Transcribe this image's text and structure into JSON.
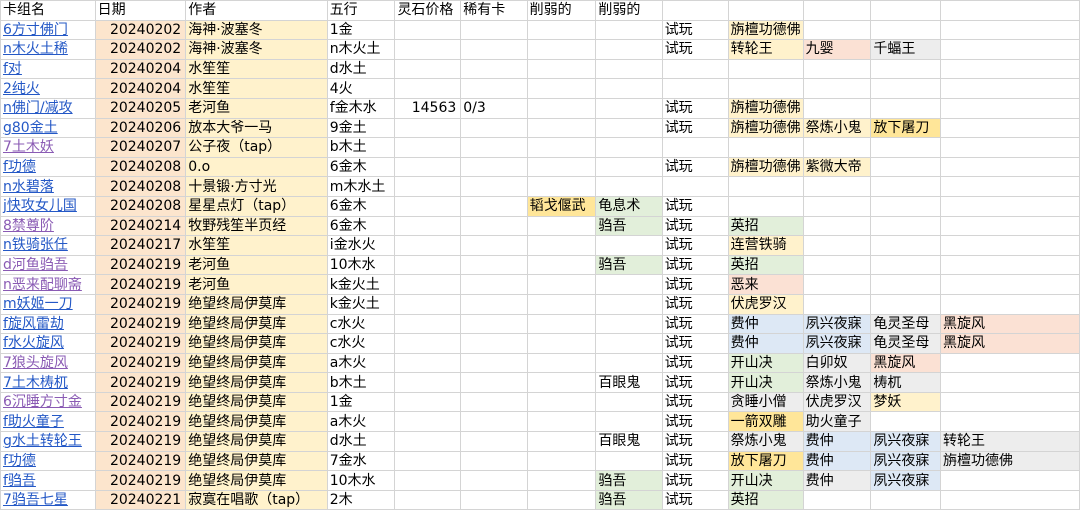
{
  "header": [
    "卡组名",
    "日期",
    "作者",
    "五行",
    "灵石价格",
    "稀有卡",
    "削弱的",
    "削弱的",
    "",
    "",
    "",
    "",
    ""
  ],
  "rows": [
    [
      "6方寸佛门",
      "20240202",
      "海神·波塞冬",
      "1金",
      "",
      "",
      "",
      "",
      "试玩",
      "旃檀功德佛",
      "",
      "",
      ""
    ],
    [
      "n木火土稀",
      "20240202",
      "海神·波塞冬",
      "n木火土",
      "",
      "",
      "",
      "",
      "试玩",
      "转轮王",
      "九婴",
      "千蝠王",
      ""
    ],
    [
      "f对",
      "20240204",
      "水笙笙",
      "d水土",
      "",
      "",
      "",
      "",
      "",
      "",
      "",
      "",
      ""
    ],
    [
      "2纯火",
      "20240204",
      "水笙笙",
      "4火",
      "",
      "",
      "",
      "",
      "",
      "",
      "",
      "",
      ""
    ],
    [
      "n佛门/减攻",
      "20240205",
      "老河鱼",
      "f金木水",
      "14563",
      "0/3",
      "",
      "",
      "试玩",
      "旃檀功德佛",
      "",
      "",
      ""
    ],
    [
      "g80金土",
      "20240206",
      "放本大爷一马",
      "9金土",
      "",
      "",
      "",
      "",
      "试玩",
      "旃檀功德佛",
      "祭炼小鬼",
      "放下屠刀",
      ""
    ],
    [
      "7土木妖",
      "20240207",
      "公子夜（tap）",
      "b木土",
      "",
      "",
      "",
      "",
      "",
      "",
      "",
      "",
      ""
    ],
    [
      "f功德",
      "20240208",
      "0.o",
      "6金木",
      "",
      "",
      "",
      "",
      "试玩",
      "旃檀功德佛",
      "紫微大帝",
      "",
      ""
    ],
    [
      "n水碧落",
      "20240208",
      "十景锻·方寸光",
      "m木水土",
      "",
      "",
      "",
      "",
      "",
      "",
      "",
      "",
      ""
    ],
    [
      "j快攻女儿国",
      "20240208",
      "星星点灯（tap）",
      "6金木",
      "",
      "",
      "韬戈偃武",
      "龟息术",
      "试玩",
      "",
      "",
      "",
      ""
    ],
    [
      "8禁尊阶",
      "20240214",
      "牧野残笙半页经",
      "6金木",
      "",
      "",
      "",
      "驺吾",
      "试玩",
      "英招",
      "",
      "",
      ""
    ],
    [
      "n铁骑张任",
      "20240217",
      "水笙笙",
      "i金水火",
      "",
      "",
      "",
      "",
      "试玩",
      "连营铁骑",
      "",
      "",
      ""
    ],
    [
      "d河鱼驺吾",
      "20240219",
      "老河鱼",
      "10木水",
      "",
      "",
      "",
      "驺吾",
      "试玩",
      "英招",
      "",
      "",
      ""
    ],
    [
      "n恶来配聊斋",
      "20240219",
      "老河鱼",
      "k金火土",
      "",
      "",
      "",
      "",
      "试玩",
      "恶来",
      "",
      "",
      ""
    ],
    [
      "m妖姬一刀",
      "20240219",
      "绝望终局伊莫库",
      "k金火土",
      "",
      "",
      "",
      "",
      "试玩",
      "伏虎罗汉",
      "",
      "",
      ""
    ],
    [
      "f旋风雷劫",
      "20240219",
      "绝望终局伊莫库",
      "c水火",
      "",
      "",
      "",
      "",
      "试玩",
      "费仲",
      "夙兴夜寐",
      "龟灵圣母",
      "黑旋风"
    ],
    [
      "f水火旋风",
      "20240219",
      "绝望终局伊莫库",
      "c水火",
      "",
      "",
      "",
      "",
      "试玩",
      "费仲",
      "夙兴夜寐",
      "龟灵圣母",
      "黑旋风"
    ],
    [
      "7狼头旋风",
      "20240219",
      "绝望终局伊莫库",
      "a木火",
      "",
      "",
      "",
      "",
      "试玩",
      "开山决",
      "白卯奴",
      "黑旋风",
      ""
    ],
    [
      "7土木梼杌",
      "20240219",
      "绝望终局伊莫库",
      "b木土",
      "",
      "",
      "",
      "百眼鬼",
      "试玩",
      "开山决",
      "祭炼小鬼",
      "梼杌",
      ""
    ],
    [
      "6沉睡方寸金",
      "20240219",
      "绝望终局伊莫库",
      "1金",
      "",
      "",
      "",
      "",
      "试玩",
      "贪睡小僧",
      "伏虎罗汉",
      "梦妖",
      ""
    ],
    [
      "f助火童子",
      "20240219",
      "绝望终局伊莫库",
      "a木火",
      "",
      "",
      "",
      "",
      "试玩",
      "一箭双雕",
      "助火童子",
      "",
      ""
    ],
    [
      "g水土转轮王",
      "20240219",
      "绝望终局伊莫库",
      "d水土",
      "",
      "",
      "",
      "百眼鬼",
      "试玩",
      "祭炼小鬼",
      "费仲",
      "夙兴夜寐",
      "转轮王",
      "千蝠王"
    ],
    [
      "f功德",
      "20240219",
      "绝望终局伊莫库",
      "7金水",
      "",
      "",
      "",
      "",
      "试玩",
      "放下屠刀",
      "费仲",
      "夙兴夜寐",
      "旃檀功德佛",
      ""
    ],
    [
      "f驺吾",
      "20240219",
      "绝望终局伊莫库",
      "10木水",
      "",
      "",
      "",
      "驺吾",
      "试玩",
      "开山决",
      "费仲",
      "夙兴夜寐",
      "",
      ""
    ],
    [
      "7驺吾七星",
      "20240221",
      "寂寞在唱歌（tap）",
      "2木",
      "",
      "",
      "",
      "驺吾",
      "试玩",
      "英招",
      "",
      "",
      ""
    ]
  ],
  "cell_colors": {
    "orange": "#fce5cd",
    "yellow": "#fff2cc",
    "green": "#e2efda",
    "blue": "#dde8f5",
    "gray": "#ededed",
    "pink": "#fbe1d4",
    "gold": "#ffe699"
  }
}
